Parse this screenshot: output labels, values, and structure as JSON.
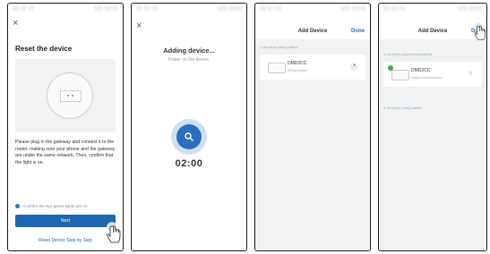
{
  "status": {
    "left": "░░ ░░ ░░",
    "right": "░░░ ░░:░░"
  },
  "screen1": {
    "close": "×",
    "title": "Reset the device",
    "instructions": "Please plug in the gateway and connect it to the router, making sure your phone and the gateway are under the same network. Then, confirm that the light is on.",
    "confirm_label": "Confirm the two green lights are on",
    "next_label": "Next",
    "reset_link": "Reset Device Step by Step"
  },
  "screen2": {
    "close": "×",
    "title": "Adding device...",
    "subtitle": "Power on the device.",
    "timer": "02:00"
  },
  "screen3": {
    "title": "Add Device",
    "done": "Done",
    "section1": "1 device(s) being added",
    "device_name": "DMD2CC",
    "device_status": "Being added"
  },
  "screen4": {
    "title": "Add Device",
    "done": "Done",
    "section1": "1 device(s) added successfully",
    "device_name": "DMD2CC",
    "device_status": "Added successfully",
    "section2": "0 device(s) being added"
  },
  "colors": {
    "accent": "#1f66b1",
    "success": "#3cb043"
  }
}
